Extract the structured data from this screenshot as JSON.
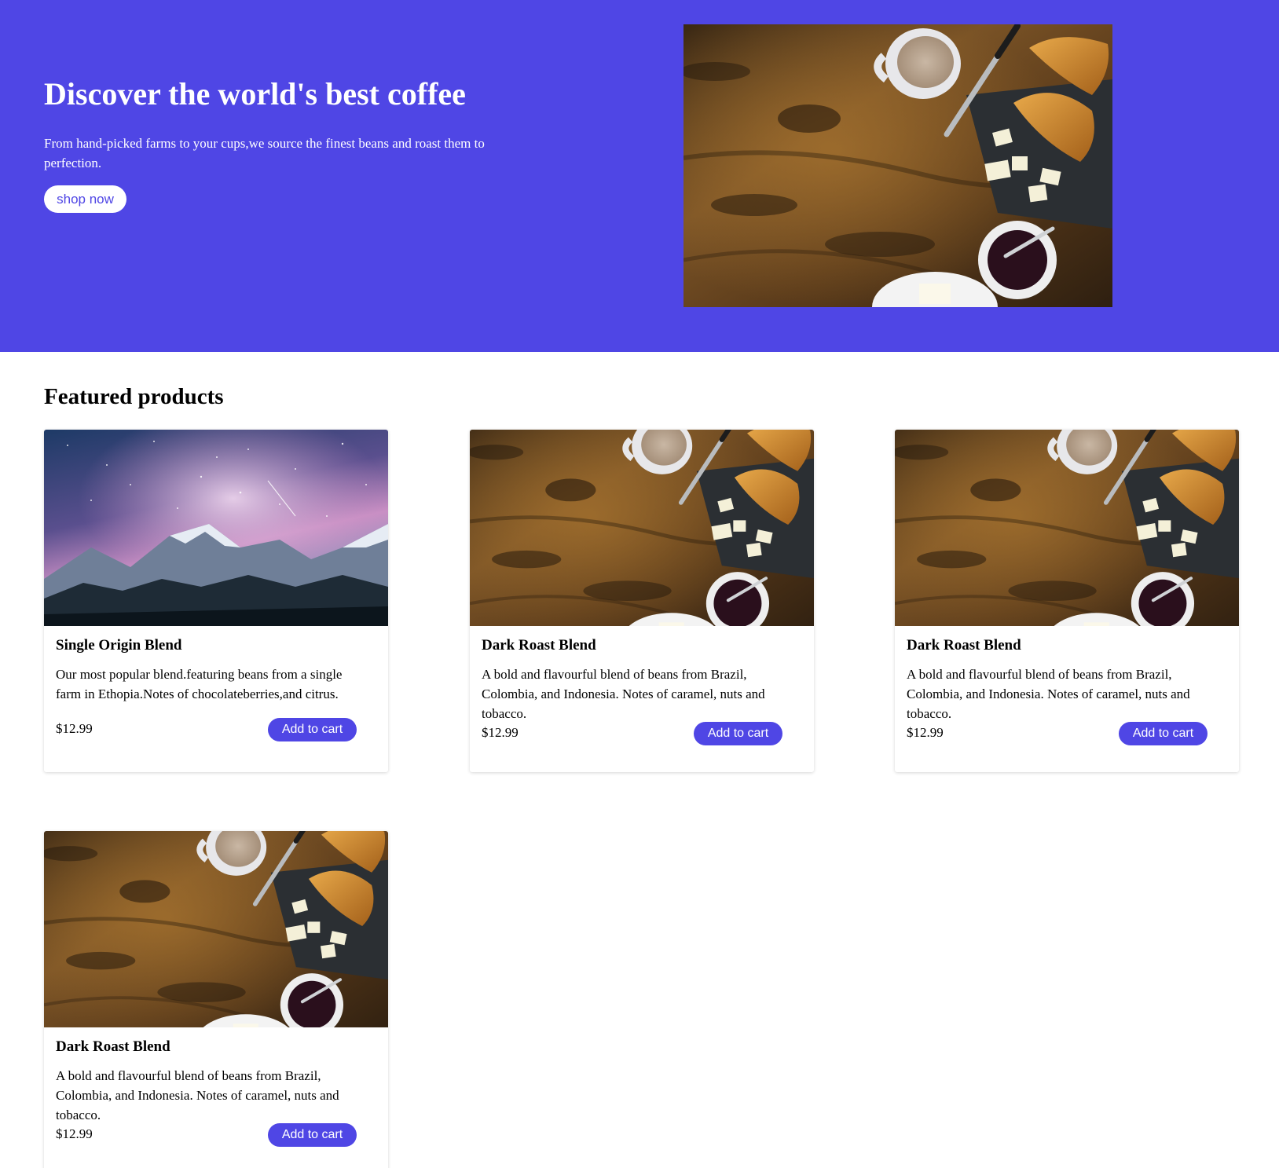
{
  "hero": {
    "title": "Discover the world's best coffee",
    "subtitle": "From hand-picked farms to your cups,we source the finest beans and roast them to perfection.",
    "cta_label": "shop now",
    "image": "coffee-breakfast-table-photo"
  },
  "featured": {
    "heading": "Featured products",
    "products": [
      {
        "image": "mountain-night-sky-photo",
        "name": "Single Origin Blend",
        "description": "Our most popular blend.featuring beans from a single farm in Ethopia.Notes of chocolateberries,and citrus.",
        "price": "$12.99",
        "button_label": "Add to cart"
      },
      {
        "image": "coffee-breakfast-table-photo",
        "name": "Dark Roast Blend",
        "description": "A bold and flavourful blend of beans from Brazil, Colombia, and Indonesia. Notes of caramel, nuts and tobacco.",
        "price": "$12.99",
        "button_label": "Add to cart"
      },
      {
        "image": "coffee-breakfast-table-photo",
        "name": "Dark Roast Blend",
        "description": "A bold and flavourful blend of beans from Brazil, Colombia, and Indonesia. Notes of caramel, nuts and tobacco.",
        "price": "$12.99",
        "button_label": "Add to cart"
      },
      {
        "image": "coffee-breakfast-table-photo",
        "name": "Dark Roast Blend",
        "description": "A bold and flavourful blend of beans from Brazil, Colombia, and Indonesia. Notes of caramel, nuts and tobacco.",
        "price": "$12.99",
        "button_label": "Add to cart"
      }
    ]
  },
  "colors": {
    "brand": "#4f46e5",
    "button_text_on_brand": "#ffffff",
    "page_background": "#ffffff"
  }
}
